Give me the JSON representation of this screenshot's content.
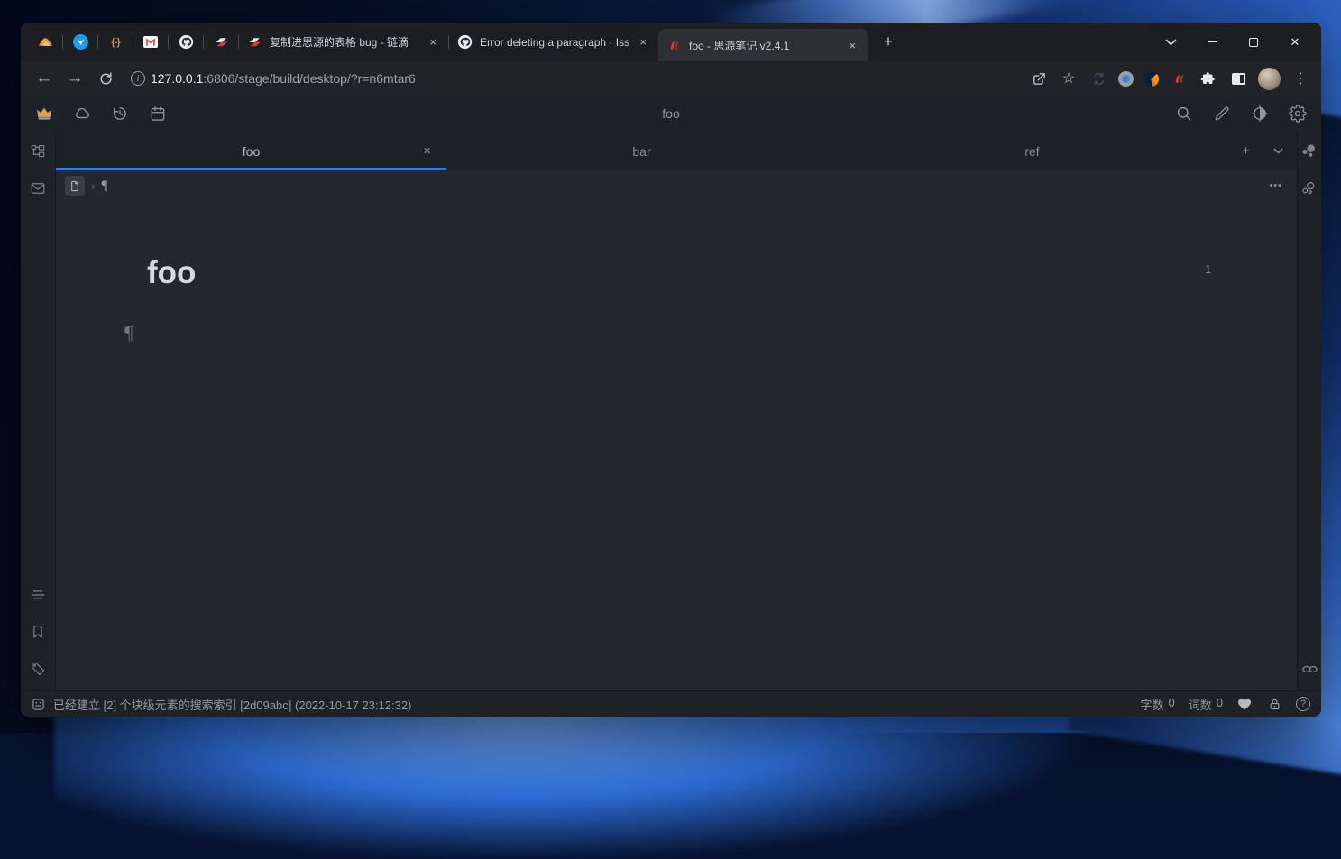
{
  "glyphs": {
    "back": "←",
    "forward": "→",
    "close": "✕",
    "small_close": "×",
    "plus": "+",
    "kebab": "⋮",
    "star": "☆",
    "braces": "{-}",
    "info": "i",
    "question": "?",
    "pilcrow": "¶",
    "breadcrumb_sep": "›",
    "more_dots": "•••"
  },
  "colors": {
    "accent": "#3575f0",
    "crown": "#e9a23b",
    "siyuan_red": "#d23f31"
  },
  "chrome": {
    "tabs": [
      {
        "title": "复制进思源的表格 bug - 链滴"
      },
      {
        "title": "Error deleting a paragraph · Iss"
      },
      {
        "title": "foo - 思源笔记 v2.4.1"
      }
    ],
    "url": {
      "host": "127.0.0.1",
      "path": ":6806/stage/build/desktop/?r=n6mtar6"
    }
  },
  "app": {
    "toolbar_title": "foo",
    "tabs": [
      {
        "label": "foo"
      },
      {
        "label": "bar"
      },
      {
        "label": "ref"
      }
    ],
    "editor": {
      "doc_title": "foo",
      "ref_count": "1"
    },
    "status": {
      "message": "已经建立 [2] 个块级元素的搜索索引 [2d09abc] (2022-10-17 23:12:32)",
      "char_label": "字数",
      "char_count": "0",
      "word_label": "词数",
      "word_count": "0"
    }
  }
}
